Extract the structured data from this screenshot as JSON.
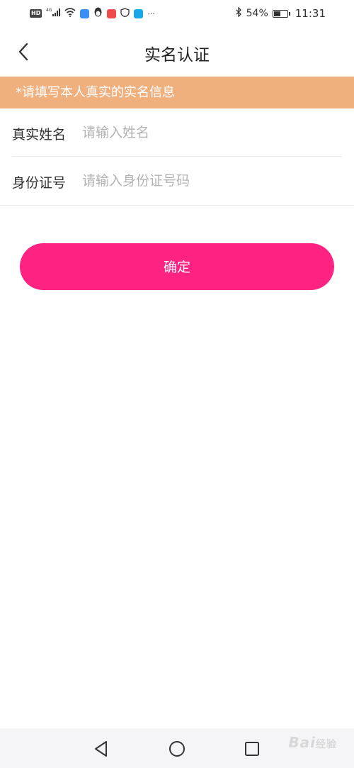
{
  "status_bar": {
    "hd_label": "HD",
    "signal_label": "4G",
    "battery_percent": "54%",
    "battery_level": 0.54,
    "time": "11:31",
    "more_indicator": "···"
  },
  "header": {
    "title": "实名认证"
  },
  "notice": {
    "text": "*请填写本人真实的实名信息",
    "background": "#f0b07e"
  },
  "form": {
    "name_label": "真实姓名",
    "name_placeholder": "请输入姓名",
    "name_value": "",
    "id_label": "身份证号",
    "id_placeholder": "请输入身份证号码",
    "id_value": ""
  },
  "confirm": {
    "label": "确定",
    "color": "#fe2282"
  },
  "nav_bar": {
    "icons": [
      "back-triangle-icon",
      "home-circle-icon",
      "recent-square-icon"
    ]
  },
  "watermark": {
    "brand": "Bai",
    "suffix": "经验"
  }
}
